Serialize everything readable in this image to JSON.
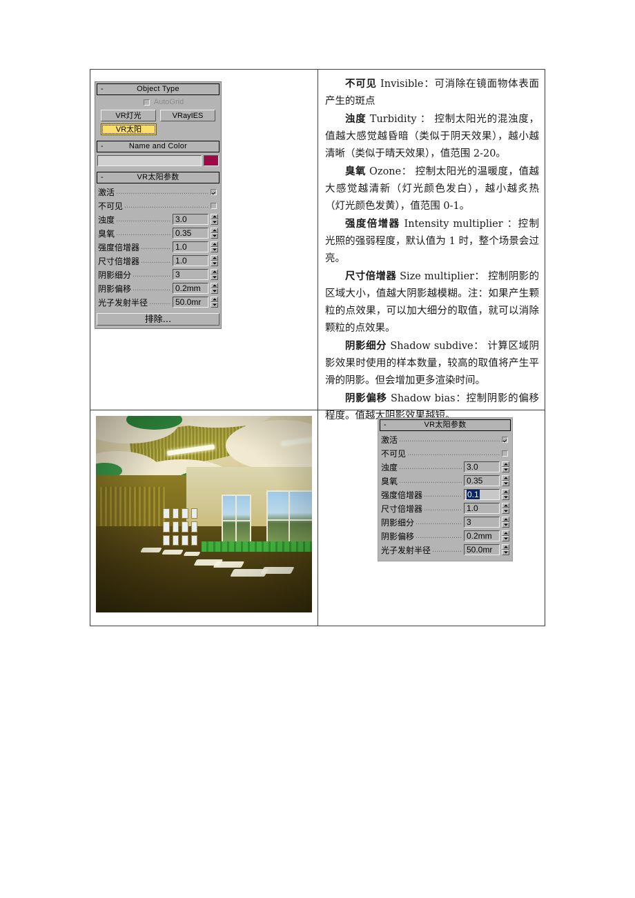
{
  "panel_top": {
    "rollups": {
      "object_type": "Object Type",
      "name_and_color": "Name and Color",
      "vr_sun_params": "VR太阳参数"
    },
    "minus": "-",
    "autogrid_label": "AutoGrid",
    "autogrid_checked": false,
    "buttons": {
      "vr_light": "VR灯光",
      "vray_ies": "VRayIES",
      "vr_sun": "VR太阳",
      "exclude": "排除..."
    },
    "name_value": "",
    "color_swatch": "#9c0b46",
    "params": [
      {
        "label": "激活",
        "type": "check",
        "checked": true
      },
      {
        "label": "不可见",
        "type": "check",
        "checked": false
      },
      {
        "label": "浊度",
        "type": "field",
        "value": "3.0"
      },
      {
        "label": "臭氧",
        "type": "field",
        "value": "0.35"
      },
      {
        "label": "强度倍增器",
        "type": "field",
        "value": "1.0"
      },
      {
        "label": "尺寸倍增器",
        "type": "field",
        "value": "1.0"
      },
      {
        "label": "阴影细分",
        "type": "field",
        "value": "3"
      },
      {
        "label": "阴影偏移",
        "type": "field",
        "value": "0.2mm"
      },
      {
        "label": "光子发射半径",
        "type": "field",
        "value": "50.0mr"
      }
    ]
  },
  "panel_bottom": {
    "rollup_title": "VR太阳参数",
    "minus": "-",
    "params": [
      {
        "label": "激活",
        "type": "check",
        "checked": true
      },
      {
        "label": "不可见",
        "type": "check",
        "checked": false
      },
      {
        "label": "浊度",
        "type": "field",
        "value": "3.0",
        "selected": false
      },
      {
        "label": "臭氧",
        "type": "field",
        "value": "0.35",
        "selected": false
      },
      {
        "label": "强度倍增器",
        "type": "field",
        "value": "0.1",
        "selected": true
      },
      {
        "label": "尺寸倍增器",
        "type": "field",
        "value": "1.0",
        "selected": false
      },
      {
        "label": "阴影细分",
        "type": "field",
        "value": "3",
        "selected": false
      },
      {
        "label": "阴影偏移",
        "type": "field",
        "value": "0.2mm",
        "selected": false
      },
      {
        "label": "光子发射半径",
        "type": "field",
        "value": "50.0mr",
        "selected": false
      }
    ],
    "selection_color": "#0a246a"
  },
  "body_text": {
    "p1": "不可见 Invisible：可消除在镜面物体表面产生的斑点",
    "p1_term": "不可见",
    "p1_rest": " Invisible：可消除在镜面物体表面产生的斑点",
    "p2_term": "浊度",
    "p2_rest": " Turbidity ： 控制太阳光的混浊度，值越大感觉越昏暗（类似于阴天效果），越小越清晰（类似于晴天效果），值范围 2-20。",
    "p3_term": "臭氧",
    "p3_rest": " Ozone：    控制太阳光的温暖度，值越大感觉越清新（灯光颜色发白），越小越炙热（灯光颜色发黄），值范围 0-1。",
    "p4_term": "强度倍增器",
    "p4_rest": " Intensity multiplier ：控制光照的强弱程度，默认值为 1 时，整个场景会过亮。",
    "p5_term": "尺寸倍增器",
    "p5_rest": " Size multiplier：  控制阴影的区域大小，值越大阴影越模糊。注：如果产生颗粒的点效果，可以加大细分的取值，就可以消除颗粒的点效果。",
    "p6_term": "阴影细分",
    "p6_rest": " Shadow subdive：   计算区域阴影效果时使用的样本数量，较高的取值将产生平滑的阴影。但会增加更多渲染时间。",
    "p7_term": "阴影偏移",
    "p7_rest": " Shadow bias：控制阴影的偏移程度。值越大阴影效果越短。"
  },
  "render_image": {
    "alt": "VRay rendered interior hall with green ceiling discs and sunlight patches"
  }
}
